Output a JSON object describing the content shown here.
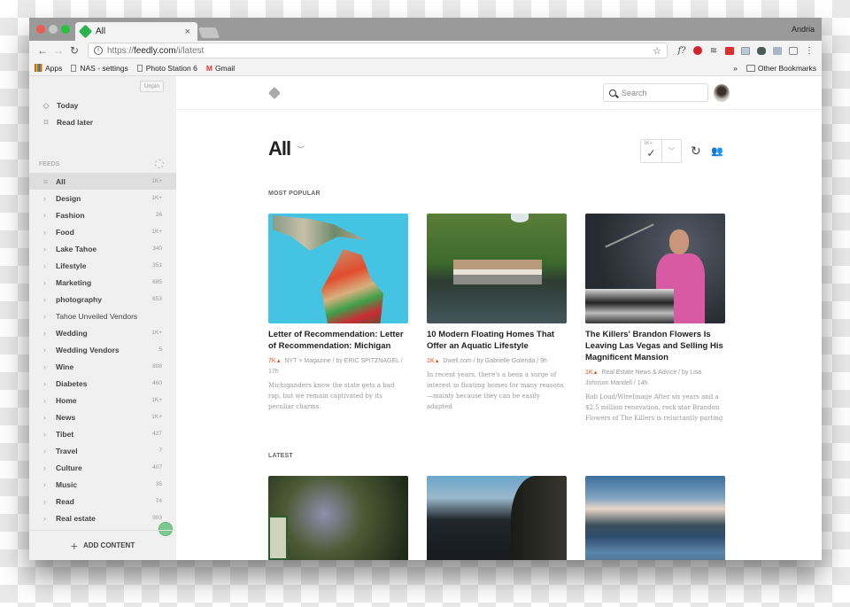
{
  "browser": {
    "tab_title": "All",
    "user_name": "Andria",
    "url_scheme": "https://",
    "url_host": "feedly.com",
    "url_path": "/i/latest",
    "bookmarks": [
      {
        "label": "Apps",
        "icon": "apps-grid-icon"
      },
      {
        "label": "NAS - settings",
        "icon": "page-icon"
      },
      {
        "label": "Photo Station 6",
        "icon": "page-icon"
      },
      {
        "label": "Gmail",
        "icon": "gmail-icon"
      }
    ],
    "bookmarks_overflow": "»",
    "other_bookmarks": "Other Bookmarks",
    "extensions": [
      "font-icon",
      "pinterest-icon",
      "buffer-icon",
      "red-extension-icon",
      "image-extension-icon",
      "evernote-icon",
      "code-extension-icon",
      "camera-icon",
      "menu-icon"
    ]
  },
  "sidebar": {
    "unpin_label": "Unpin",
    "links": [
      {
        "label": "Today",
        "icon": "today-icon"
      },
      {
        "label": "Read later",
        "icon": "bookmark-icon"
      }
    ],
    "feeds_header": "FEEDS",
    "feeds": [
      {
        "label": "All",
        "count": "1K+",
        "active": true
      },
      {
        "label": "Design",
        "count": "1K+"
      },
      {
        "label": "Fashion",
        "count": "26"
      },
      {
        "label": "Food",
        "count": "1K+"
      },
      {
        "label": "Lake Tahoe",
        "count": "340"
      },
      {
        "label": "Lifestyle",
        "count": "351"
      },
      {
        "label": "Marketing",
        "count": "685"
      },
      {
        "label": "photography",
        "count": "653"
      },
      {
        "label": "Tahoe Unveiled Vendors",
        "count": ""
      },
      {
        "label": "Wedding",
        "count": "1K+"
      },
      {
        "label": "Wedding Vendors",
        "count": "5"
      },
      {
        "label": "Wine",
        "count": "808"
      },
      {
        "label": "Diabetes",
        "count": "460"
      },
      {
        "label": "Home",
        "count": "1K+"
      },
      {
        "label": "News",
        "count": "1K+"
      },
      {
        "label": "Tibet",
        "count": "427"
      },
      {
        "label": "Travel",
        "count": "7"
      },
      {
        "label": "Culture",
        "count": "407"
      },
      {
        "label": "Music",
        "count": "35"
      },
      {
        "label": "Read",
        "count": "74"
      },
      {
        "label": "Real estate",
        "count": "903"
      }
    ],
    "add_content_label": "ADD CONTENT"
  },
  "main": {
    "search_placeholder": "Search",
    "title": "All",
    "mark_read_badge": "1K+",
    "most_popular_label": "MOST POPULAR",
    "latest_label": "LATEST",
    "popular": [
      {
        "title": "Letter of Recommendation: Letter of Recommendation: Michigan",
        "popularity": "7K",
        "source": "NYT > Magazine / by ERIC SPITZNAGEL / 17h",
        "snippet": "Michiganders know the state gets a bad rap, but we remain captivated by its peculiar charms."
      },
      {
        "title": "10 Modern Floating Homes That Offer an Aquatic Lifestyle",
        "popularity": "1K",
        "source": "Dwell.com / by Gabrielle Golenda / 9h",
        "snippet": "In recent years, there's a been a surge of interest in floating homes for many reasons —mainly because they can be easily adapted"
      },
      {
        "title": "The Killers' Brandon Flowers Is Leaving Las Vegas and Selling His Magnificent Mansion",
        "popularity": "1K",
        "source": "Real Estate News & Advice / by Lisa Johnson Mandell / 14h",
        "snippet": "Rob Loud/WireImage After six years and a $2.5 million renovation, rock star Brandon Flowers of The Killers is reluctantly parting"
      }
    ],
    "popularity_icon": "🔥"
  },
  "colors": {
    "accent_green": "#2bb24c",
    "popularity_red": "#e84d1c"
  }
}
